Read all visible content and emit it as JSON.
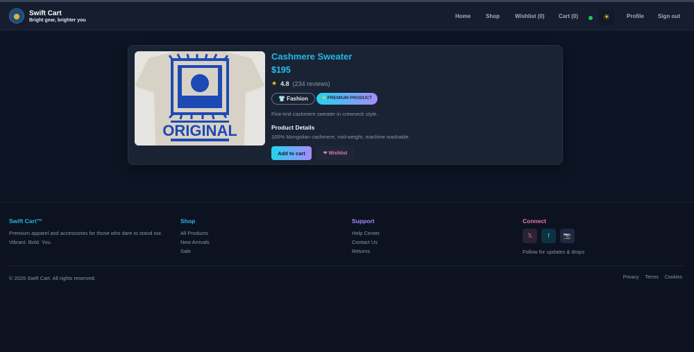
{
  "header": {
    "brand": "Swift Cart",
    "tagline": "Bright gear, brighter you",
    "nav": [
      "Home",
      "Shop",
      "Wishlist (0)",
      "Cart (0)",
      "Profile",
      "Sign out"
    ],
    "theme_icon": "sun-icon",
    "status": "online"
  },
  "product": {
    "name": "Cashmere Sweater",
    "price": "$195",
    "rating": "4.8",
    "reviews": "(234 reviews)",
    "category": "Fashion",
    "badge": "PREMIUM PRODUCT",
    "description": "Fine-knit cashmere sweater in crewneck style.",
    "details_heading": "Product Details",
    "details": "100% Mongolian cashmere, mid-weight, machine washable.",
    "add_to_cart": "Add to cart",
    "wishlist": "Wishlist",
    "image_text": "ORIGINAL"
  },
  "footer": {
    "brand": {
      "title": "Swift Cart™",
      "text": "Premium apparel and accessories for those who dare to stand out. Vibrant. Bold. You."
    },
    "shop": {
      "title": "Shop",
      "links": [
        "All Products",
        "New Arrivals",
        "Sale"
      ]
    },
    "support": {
      "title": "Support",
      "links": [
        "Help Center",
        "Contact Us",
        "Returns"
      ]
    },
    "connect": {
      "title": "Connect",
      "text": "Follow for updates & drops",
      "icons": [
        "𝕏",
        "f",
        "📷"
      ]
    },
    "copyright": "© 2025 Swift Cart. All rights reserved.",
    "legal": [
      "Privacy",
      "Terms",
      "Cookies"
    ]
  },
  "colors": {
    "accent_cyan": "#22b8e6",
    "accent_purple": "#a78bfa",
    "accent_pink": "#e879a9"
  }
}
